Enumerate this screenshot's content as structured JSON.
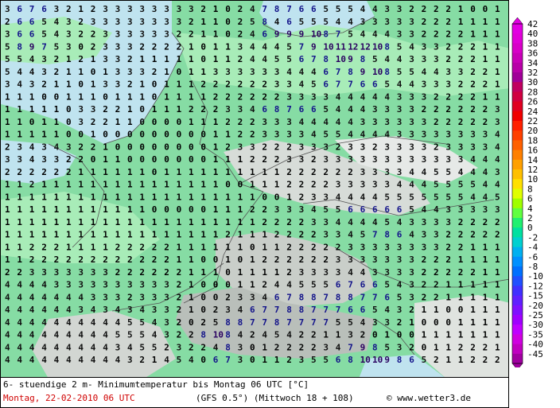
{
  "caption": {
    "title": "6- stuendige 2 m- Minimumtemperatur bis Montag 06 UTC [°C]",
    "date": "Montag, 22-02-2010  06 UTC",
    "model": "(GFS 0.5°)  (Mittwoch 18 + 108)",
    "credit": "© www.wetter3.de"
  },
  "legend": {
    "levels": [
      "42",
      "40",
      "38",
      "36",
      "34",
      "32",
      "30",
      "28",
      "26",
      "24",
      "22",
      "20",
      "18",
      "16",
      "14",
      "12",
      "10",
      "8",
      "6",
      "4",
      "2",
      "0",
      "-2",
      "-4",
      "-6",
      "-8",
      "-10",
      "-12",
      "-15",
      "-20",
      "-25",
      "-30",
      "-35",
      "-40",
      "-45"
    ],
    "colors": [
      "#e200e2",
      "#e000d8",
      "#d800c8",
      "#c800b8",
      "#b800a8",
      "#a00098",
      "#c00060",
      "#d00040",
      "#e00020",
      "#f00000",
      "#ff2000",
      "#ff4000",
      "#ff6000",
      "#ff8000",
      "#ffa000",
      "#ffc000",
      "#ffe000",
      "#e0ff00",
      "#a0ff00",
      "#60ff40",
      "#20f070",
      "#00e0a0",
      "#00d0d0",
      "#00b0f0",
      "#0090ff",
      "#0070ff",
      "#2050ff",
      "#4030ff",
      "#6020ff",
      "#8010ff",
      "#a000ff",
      "#c000ff",
      "#d000e0",
      "#c000c0",
      "#a000a0"
    ]
  },
  "map": {
    "rows": [
      "3 6 7 6 3 2 1 2 3 3 3 3 3 3 3 3 2 1 0 2 4 7 8 7 6 6 5 5 5 4 4 3 3 2 2 2 2 1 0 0 1",
      "2 6 6 5 4 3 2 3 3 3 3 3 3 3 3 2 1 1 0 2 5 8 4 6 5 5 5 4 4 3 3 3 3 3 2 2 2 1 1 1 1",
      "3 6 6 5 4 3 2 2 3 3 3 3 3 3 2 2 1 1 0 2 4 6 9 9 9 10 8 7 5 4 4 4 3 3 2 2 2 2 1 1 1",
      "5 8 9 7 5 3 0 2 3 3 3 2 2 2 2 1 0 1 1 3 4 4 4 5 7 9 10 11 12 12 10 8 5 4 3 3 2 2 2 1 1",
      "5 5 4 3 2 1 2 1 3 3 2 1 1 1 1 1 0 1 1 2 4 4 5 5 6 7 8 10 9 8 5 4 4 3 3 3 2 2 2 1 1",
      "5 4 4 3 2 1 1 0 1 3 3 3 2 1 0 1 1 3 3 3 3 3 3 4 4 4 6 7 8 9 10 8 5 5 4 4 3 3 2 2 1",
      "3 4 3 2 1 1 0 1 3 3 2 1 0 1 1 1 2 2 2 2 2 2 3 3 4 5 6 7 7 6 6 5 4 4 3 3 3 2 2 2 1",
      "1 1 1 0 0 1 1 1 0 1 1 1 0 1 1 1 1 2 2 2 2 2 2 3 3 3 3 4 4 4 4 4 3 3 3 2 2 2 2 1 1",
      "1 1 1 1 1 0 3 3 2 2 1 0 1 1 1 2 2 2 3 3 4 6 8 7 6 6 5 4 4 4 3 3 3 3 2 2 2 2 2 2 3",
      "1 1 0 1 1 0 3 2 2 1 1 0 0 0 0 1 1 1 2 2 2 3 3 3 4 4 4 4 4 3 3 3 3 3 3 2 2 2 2 2 3",
      "1 1 1 1 1 0 0 1 0 0 0 0 0 0 0 0 0 1 1 2 2 3 3 3 3 4 5 5 4 4 4 4 3 3 3 3 3 3 3 3 4",
      "2 3 4 3 4 3 2 2 1 0 0 0 0 0 0 0 0 1 2 3 3 2 2 2 3 3 3 2 3 3 2 3 3 3 3 2 3 3 3 3 4",
      "3 3 4 3 3 2 2 0 1 1 0 0 0 0 0 0 0 1 1 1 2 2 2 3 3 2 3 3 3 3 3 3 3 3 3 3 3 3 4 4 4",
      "2 2 2 2 2 2 1 1 1 1 1 1 0 1 1 1 1 1 1 1 1 1 1 2 2 2 2 2 2 3 3 3 3 4 4 5 5 4 4 4 3",
      "1 1 2 1 1 1 1 1 1 1 1 1 1 1 1 1 1 1 0 0 1 1 1 2 2 2 2 3 3 3 3 3 4 4 4 5 5 5 5 4 4",
      "1 1 1 1 1 1 1 1 1 1 1 1 1 1 1 1 1 1 1 1 1 0 0 1 2 3 3 4 4 4 4 5 5 5 5 5 5 5 4 4 5",
      "1 1 1 1 1 1 1 1 1 1 1 1 0 0 0 0 0 1 1 1 2 2 3 3 3 4 5 5 6 6 6 6 6 5 4 4 3 3 3 3 3",
      "1 1 1 1 1 1 1 1 1 1 1 1 1 1 1 1 1 1 1 1 1 2 2 2 2 3 3 4 4 4 4 5 4 3 3 3 3 2 2 2 2",
      "1 1 1 1 1 1 1 1 1 1 1 1 1 1 1 1 1 1 2 1 1 1 2 2 2 2 3 3 4 5 7 8 6 4 3 3 2 2 2 2 2",
      "1 1 2 2 2 1 1 1 1 2 2 2 2 2 1 1 1 1 1 1 0 1 1 2 2 2 2 2 3 3 3 3 3 3 3 3 2 2 1 1 1",
      "1 1 2 2 2 2 2 2 2 2 2 2 2 2 1 1 0 0 1 0 1 2 2 2 2 2 2 3 3 3 3 3 3 3 2 2 2 1 1 1 1",
      "2 2 3 3 3 3 3 3 3 2 2 2 2 2 2 1 1 1 0 1 1 1 1 2 3 3 3 3 4 4 3 3 3 3 2 2 2 2 2 1 1",
      "4 4 4 4 3 3 3 3 3 3 3 3 3 3 2 1 0 0 0 1 1 2 4 4 5 5 5 6 7 6 6 5 4 3 2 2 1 1 1 1 1",
      "4 4 4 4 4 4 4 3 3 3 2 3 3 3 2 1 0 0 2 3 3 4 6 7 8 8 7 8 8 7 7 6 5 3 2 2 1 1 1 1 1",
      "4 4 4 4 4 4 3 4 3 4 3 4 3 3 2 1 0 2 3 4 6 7 7 8 8 7 7 7 6 6 5 4 3 2 1 1 0 0 1 1 1",
      "4 4 4 4 4 4 4 4 4 4 5 5 4 3 2 0 2 5 8 8 7 7 8 7 7 7 7 5 5 4 3 3 2 1 0 0 0 1 1 1 1",
      "4 4 4 4 4 4 4 4 4 5 5 5 4 3 2 2 8 10 8 4 2 4 5 4 2 2 1 1 3 2 0 1 0 0 1 1 1 1 1 1 1",
      "4 4 4 4 4 4 4 4 4 3 4 5 5 2 3 2 2 4 8 3 0 1 2 2 2 2 3 4 7 9 8 5 3 2 0 1 1 2 2 2 1",
      "4 4 4 4 4 4 4 4 4 4 3 2 1 4 5 4 0 6 7 3 0 1 1 2 3 5 5 6 8 10 10 9 8 6 5 2 1 1 2 2 2"
    ]
  }
}
